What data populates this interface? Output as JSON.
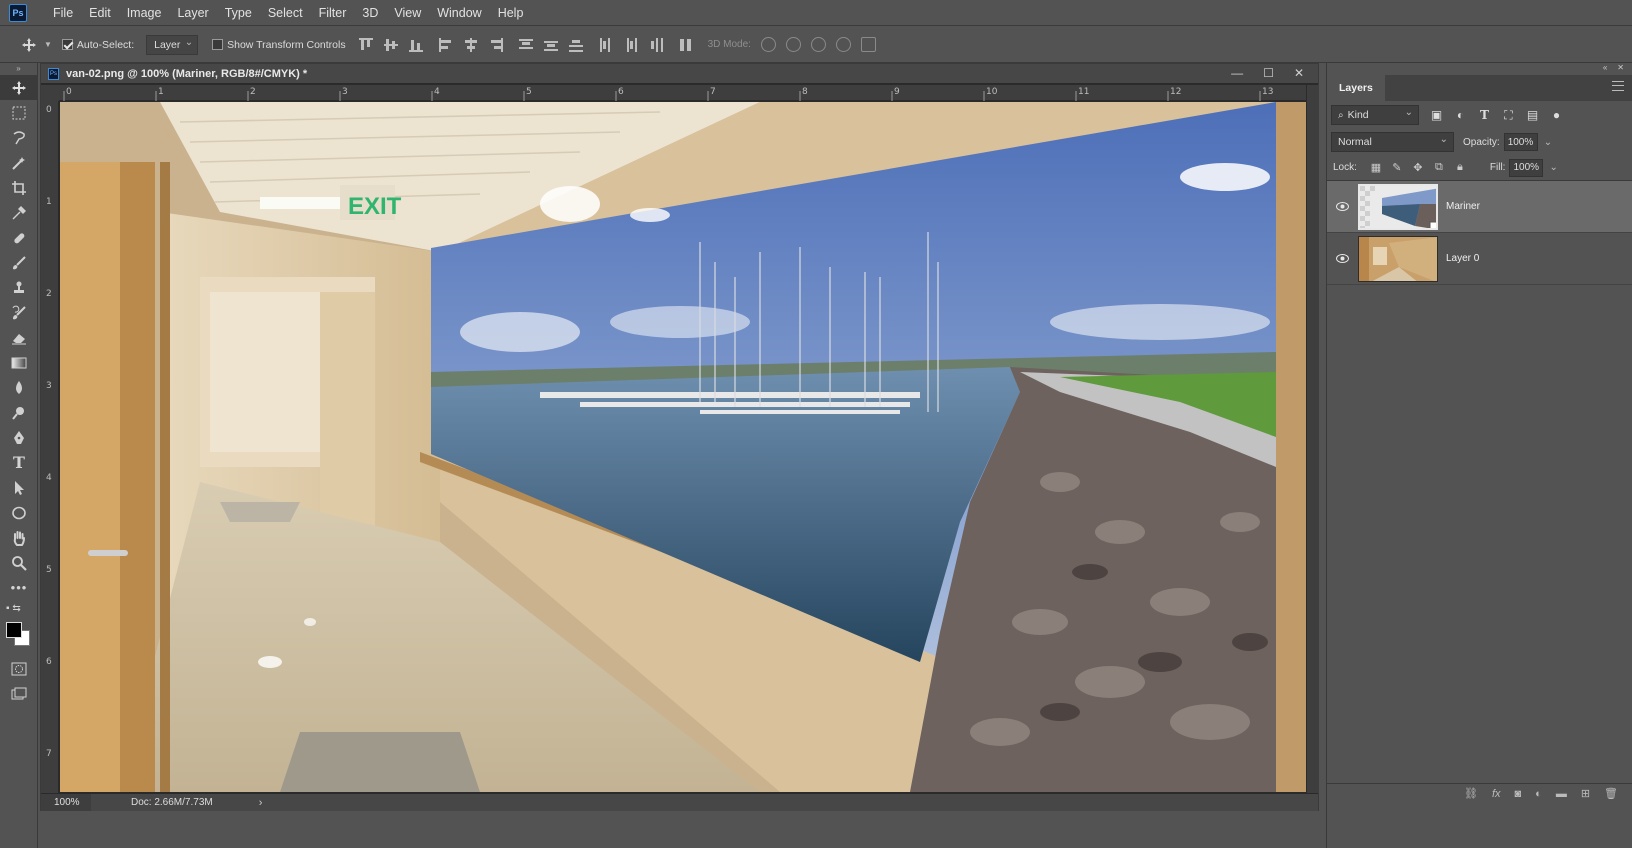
{
  "app": {
    "logo_text": "Ps"
  },
  "menu": [
    "File",
    "Edit",
    "Image",
    "Layer",
    "Type",
    "Select",
    "Filter",
    "3D",
    "View",
    "Window",
    "Help"
  ],
  "options": {
    "auto_select_label": "Auto-Select:",
    "auto_select_checked": true,
    "auto_select_target": "Layer",
    "transform_controls_label": "Show Transform Controls",
    "transform_controls_checked": false,
    "mode_label": "3D Mode:"
  },
  "document": {
    "tab_title": "van-02.png @ 100% (Mariner, RGB/8#/CMYK) *",
    "ruler_top": [
      "0",
      "1",
      "2",
      "3",
      "4",
      "5",
      "6",
      "7",
      "8",
      "9",
      "10",
      "11",
      "12",
      "13"
    ],
    "ruler_left": [
      "0",
      "1",
      "2",
      "3",
      "4",
      "5",
      "6",
      "7"
    ],
    "canvas_sign_text": "EXIT"
  },
  "status": {
    "zoom": "100%",
    "doc": "Doc: 2.66M/7.73M"
  },
  "layers_panel": {
    "tab_label": "Layers",
    "filter_kind": "Kind",
    "blend_mode": "Normal",
    "opacity_label": "Opacity:",
    "opacity_value": "100%",
    "lock_label": "Lock:",
    "fill_label": "Fill:",
    "fill_value": "100%",
    "layers": [
      {
        "name": "Mariner",
        "selected": true,
        "visible": true
      },
      {
        "name": "Layer 0",
        "selected": false,
        "visible": true
      }
    ]
  },
  "colors": {
    "foreground": "#000000",
    "background": "#ffffff",
    "ui_bg": "#535353"
  }
}
